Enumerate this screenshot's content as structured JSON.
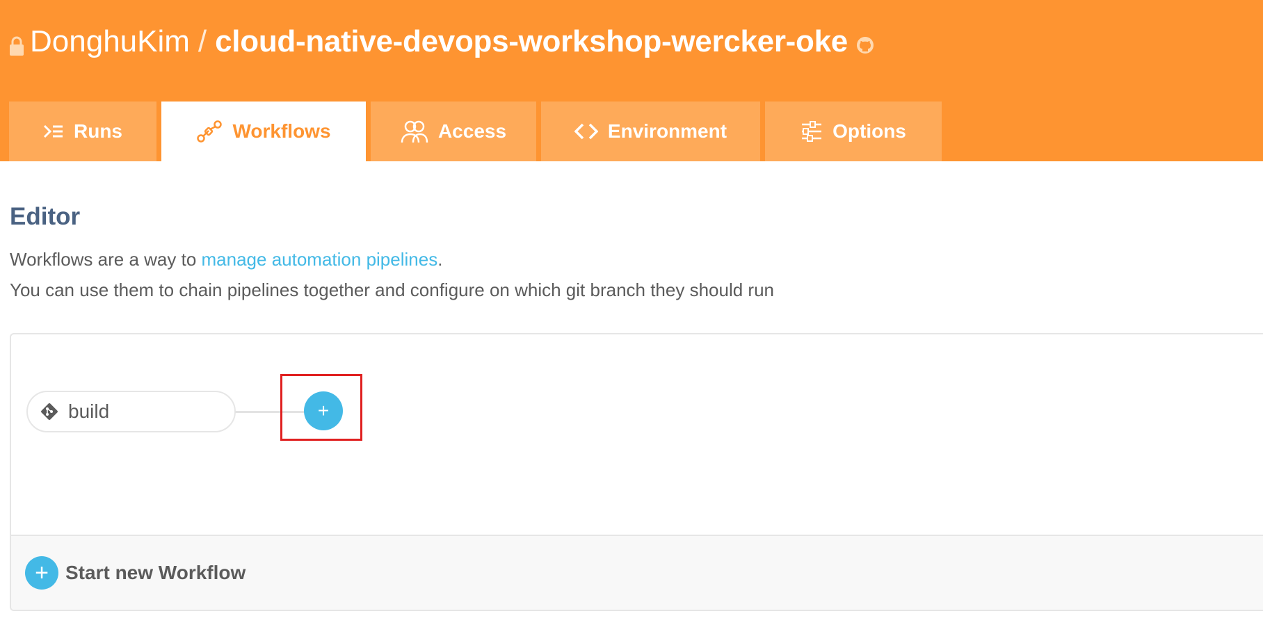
{
  "header": {
    "owner": "DonghuKim",
    "separator": "/",
    "repo_name": "cloud-native-devops-workshop-wercker-oke",
    "lock_icon": "lock-icon",
    "github_icon": "github-icon",
    "background_color": "#fe9431"
  },
  "tabs": [
    {
      "label": "Runs",
      "icon": "runs-icon",
      "active": false
    },
    {
      "label": "Workflows",
      "icon": "workflows-icon",
      "active": true
    },
    {
      "label": "Access",
      "icon": "access-icon",
      "active": false
    },
    {
      "label": "Environment",
      "icon": "code-brackets-icon",
      "active": false
    },
    {
      "label": "Options",
      "icon": "sliders-icon",
      "active": false
    }
  ],
  "editor": {
    "title": "Editor",
    "desc_line1_prefix": "Workflows are a way to ",
    "desc_line1_link": "manage automation pipelines",
    "desc_line1_suffix": ".",
    "desc_line2": "You can use them to chain pipelines together and configure on which git branch they should run",
    "link_color": "#43b9e6"
  },
  "workflow": {
    "pipeline_label": "build",
    "pipeline_icon": "git-icon",
    "add_button_label": "+",
    "footer_plus_label": "+",
    "start_new_label": "Start new Workflow",
    "accent_color": "#43b9e6",
    "highlight_color": "#e02020"
  }
}
